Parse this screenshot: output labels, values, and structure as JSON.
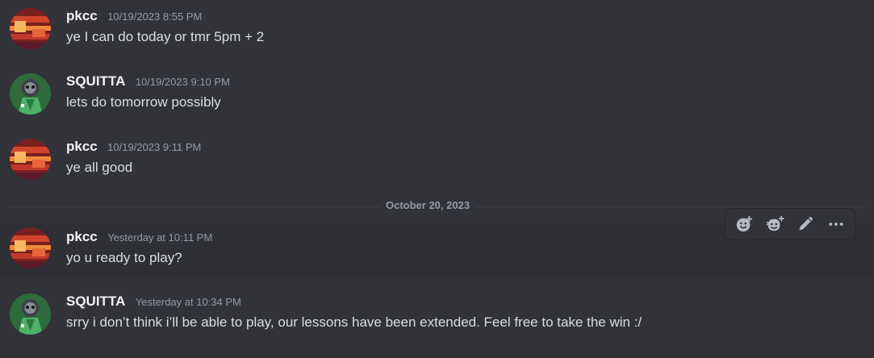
{
  "colors": {
    "background": "#313338",
    "hover_background": "#2e3035",
    "username": "#f2f3f5",
    "message_text": "#dbdee1",
    "timestamp": "#949ba4",
    "divider": "#3f4147",
    "pkcc_avatar": "#c0392b",
    "squitta_avatar": "#3ba55c"
  },
  "messages": [
    {
      "username": "pkcc",
      "timestamp": "10/19/2023 8:55 PM",
      "content": "ye I can do today or tmr 5pm + 2",
      "avatar_icon": "pkcc-avatar"
    },
    {
      "username": "SQUITTA",
      "timestamp": "10/19/2023 9:10 PM",
      "content": "lets do tomorrow possibly",
      "avatar_icon": "squitta-avatar"
    },
    {
      "username": "pkcc",
      "timestamp": "10/19/2023 9:11 PM",
      "content": "ye all good",
      "avatar_icon": "pkcc-avatar"
    },
    {
      "username": "pkcc",
      "timestamp": "Yesterday at 10:11 PM",
      "content": "yo u ready to play?",
      "avatar_icon": "pkcc-avatar"
    },
    {
      "username": "SQUITTA",
      "timestamp": "Yesterday at 10:34 PM",
      "content": "srry i don’t think i’ll be able to play, our lessons have been extended. Feel free to take the win :/",
      "avatar_icon": "squitta-avatar"
    }
  ],
  "date_divider": "October 20, 2023",
  "toolbar": {
    "icons": [
      "add-reaction-icon",
      "add-super-reaction-icon",
      "edit-icon",
      "more-options-icon"
    ]
  }
}
